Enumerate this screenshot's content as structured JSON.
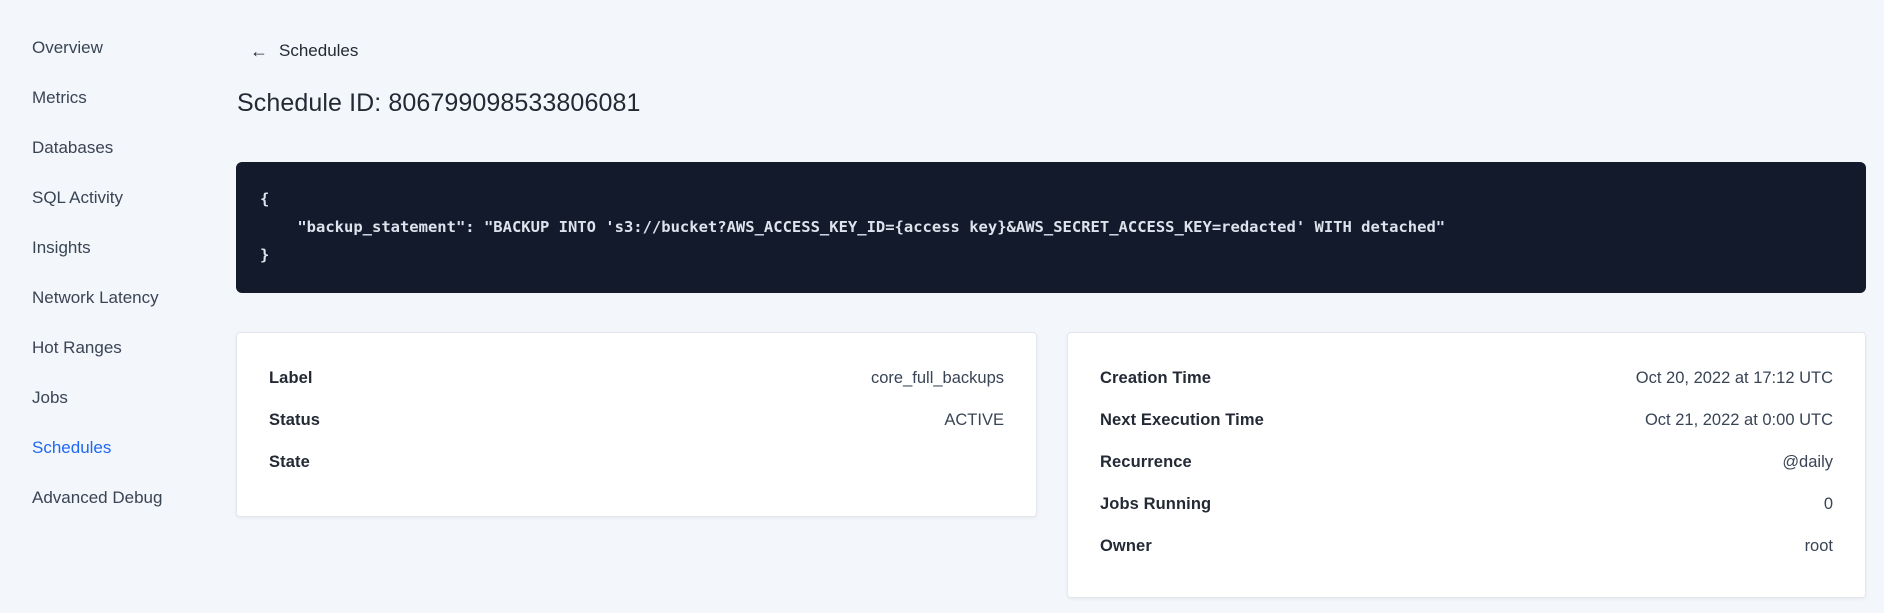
{
  "sidebar": {
    "items": [
      {
        "label": "Overview",
        "active": false
      },
      {
        "label": "Metrics",
        "active": false
      },
      {
        "label": "Databases",
        "active": false
      },
      {
        "label": "SQL Activity",
        "active": false
      },
      {
        "label": "Insights",
        "active": false
      },
      {
        "label": "Network Latency",
        "active": false
      },
      {
        "label": "Hot Ranges",
        "active": false
      },
      {
        "label": "Jobs",
        "active": false
      },
      {
        "label": "Schedules",
        "active": true
      },
      {
        "label": "Advanced Debug",
        "active": false
      }
    ],
    "active_color": "#2068f3"
  },
  "header": {
    "back_icon": "←",
    "back_label": "Schedules",
    "title": "Schedule ID: 806799098533806081"
  },
  "code_block": {
    "background": "#131a2b",
    "text_color": "#dce3ec",
    "lines": [
      {
        "text": "{"
      },
      {
        "text": "    \"backup_statement\": \"BACKUP INTO 's3://bucket?AWS_ACCESS_KEY_ID={access key}&AWS_SECRET_ACCESS_KEY=redacted' WITH detached\""
      },
      {
        "text": "}"
      }
    ]
  },
  "status_card": {
    "rows": [
      {
        "label": "Label",
        "value": "core_full_backups"
      },
      {
        "label": "Status",
        "value": "ACTIVE"
      },
      {
        "label": "State",
        "value": ""
      }
    ]
  },
  "execution_card": {
    "rows": [
      {
        "label": "Creation Time",
        "value": "Oct 20, 2022 at 17:12 UTC"
      },
      {
        "label": "Next Execution Time",
        "value": "Oct 21, 2022 at 0:00 UTC"
      },
      {
        "label": "Recurrence",
        "value": "@daily"
      },
      {
        "label": "Jobs Running",
        "value": "0"
      },
      {
        "label": "Owner",
        "value": "root"
      }
    ]
  }
}
